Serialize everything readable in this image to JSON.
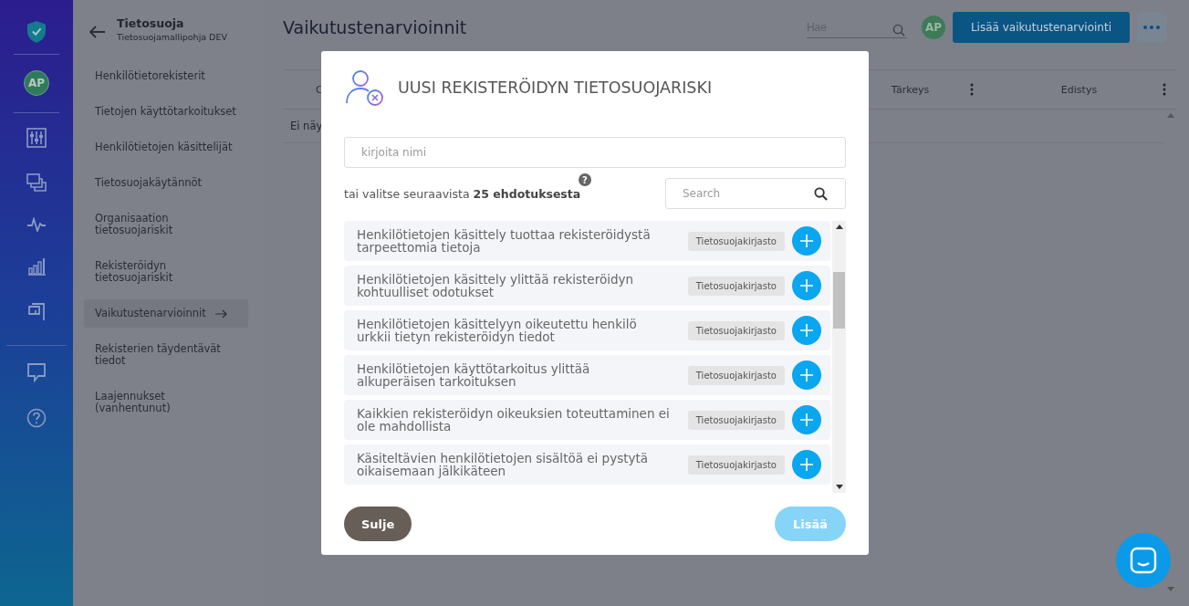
{
  "rail": {
    "avatar": "AP"
  },
  "nav": {
    "title": "Tietosuoja",
    "subtitle": "Tietosuojamallipohja DEV",
    "items": [
      {
        "label": "Henkilötietorekisterit",
        "selected": false
      },
      {
        "label": "Tietojen käyttötarkoitukset",
        "selected": false
      },
      {
        "label": "Henkilötietojen käsittelijät",
        "selected": false
      },
      {
        "label": "Tietosuojakäytännöt",
        "selected": false
      },
      {
        "label": "Organisaation tietosuojariskit",
        "selected": false
      },
      {
        "label": "Rekisteröidyn tietosuojariskit",
        "selected": false
      },
      {
        "label": "Vaikutustenarvioinnit",
        "selected": true
      },
      {
        "label": "Rekisterien täydentävät tiedot",
        "selected": false
      },
      {
        "label": "Laajennukset (vanhentunut)",
        "selected": false
      }
    ]
  },
  "header": {
    "title": "Vaikutustenarvioinnit",
    "search": {
      "placeholder": "Hae"
    },
    "avatar": "AP",
    "primary_button": "Lisää vaikutustenarviointi"
  },
  "table": {
    "columns": [
      "C",
      "Tärkeys",
      "Edistys"
    ],
    "empty_text": "Ei näy"
  },
  "modal": {
    "title": "UUSI REKISTERÖIDYN TIETOSUOJARISKI",
    "name_field": {
      "placeholder": "kirjoita nimi"
    },
    "suggestion_text": "tai valitse seuraavista **25 ehdotuksesta**",
    "help": "?",
    "search": {
      "placeholder": "Search"
    },
    "suggestions": [
      {
        "text": "Henkilötietojen käsittely tuottaa rekisteröidystä tarpeettomia tietoja",
        "tag": "Tietosuojakirjasto"
      },
      {
        "text": "Henkilötietojen käsittely ylittää rekisteröidyn kohtuulliset odotukset",
        "tag": "Tietosuojakirjasto"
      },
      {
        "text": "Henkilötietojen käsittelyyn oikeutettu henkilö urkkii tietyn rekisteröidyn tiedot",
        "tag": "Tietosuojakirjasto"
      },
      {
        "text": "Henkilötietojen käyttötarkoitus ylittää alkuperäisen tarkoituksen",
        "tag": "Tietosuojakirjasto"
      },
      {
        "text": "Kaikkien rekisteröidyn oikeuksien toteuttaminen ei ole mahdollista",
        "tag": "Tietosuojakirjasto"
      },
      {
        "text": "Käsiteltävien henkilötietojen sisältöä ei pystytä oikaisemaan jälkikäteen",
        "tag": "Tietosuojakirjasto"
      }
    ],
    "close_button": "Sulje",
    "add_button": {
      "label": "Lisää",
      "disabled": true
    }
  }
}
